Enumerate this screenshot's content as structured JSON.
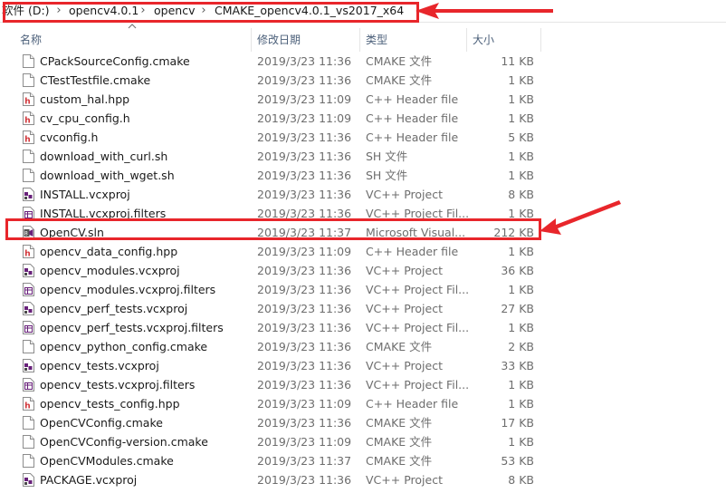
{
  "breadcrumb": {
    "items": [
      "软件 (D:)",
      "opencv4.0.1",
      "opencv",
      "CMAKE_opencv4.0.1_vs2017_x64"
    ],
    "separator": "›"
  },
  "columns": {
    "name": "名称",
    "date": "修改日期",
    "type": "类型",
    "size": "大小"
  },
  "files": [
    {
      "name": "CPackSourceConfig.cmake",
      "date": "2019/3/23 11:36",
      "type": "CMAKE 文件",
      "size": "11 KB",
      "icon": "generic-file-icon"
    },
    {
      "name": "CTestTestfile.cmake",
      "date": "2019/3/23 11:36",
      "type": "CMAKE 文件",
      "size": "1 KB",
      "icon": "generic-file-icon"
    },
    {
      "name": "custom_hal.hpp",
      "date": "2019/3/23 11:09",
      "type": "C++ Header file",
      "size": "1 KB",
      "icon": "cpp-header-icon"
    },
    {
      "name": "cv_cpu_config.h",
      "date": "2019/3/23 11:09",
      "type": "C++ Header file",
      "size": "1 KB",
      "icon": "cpp-header-icon"
    },
    {
      "name": "cvconfig.h",
      "date": "2019/3/23 11:36",
      "type": "C++ Header file",
      "size": "5 KB",
      "icon": "cpp-header-icon"
    },
    {
      "name": "download_with_curl.sh",
      "date": "2019/3/23 11:36",
      "type": "SH 文件",
      "size": "1 KB",
      "icon": "generic-file-icon"
    },
    {
      "name": "download_with_wget.sh",
      "date": "2019/3/23 11:36",
      "type": "SH 文件",
      "size": "1 KB",
      "icon": "generic-file-icon"
    },
    {
      "name": "INSTALL.vcxproj",
      "date": "2019/3/23 11:36",
      "type": "VC++ Project",
      "size": "8 KB",
      "icon": "vcxproj-icon"
    },
    {
      "name": "INSTALL.vcxproj.filters",
      "date": "2019/3/23 11:36",
      "type": "VC++ Project Fil...",
      "size": "1 KB",
      "icon": "filters-file-icon"
    },
    {
      "name": "OpenCV.sln",
      "date": "2019/3/23 11:37",
      "type": "Microsoft Visual...",
      "size": "212 KB",
      "icon": "solution-file-icon"
    },
    {
      "name": "opencv_data_config.hpp",
      "date": "2019/3/23 11:09",
      "type": "C++ Header file",
      "size": "1 KB",
      "icon": "cpp-header-icon"
    },
    {
      "name": "opencv_modules.vcxproj",
      "date": "2019/3/23 11:36",
      "type": "VC++ Project",
      "size": "36 KB",
      "icon": "vcxproj-icon"
    },
    {
      "name": "opencv_modules.vcxproj.filters",
      "date": "2019/3/23 11:36",
      "type": "VC++ Project Fil...",
      "size": "1 KB",
      "icon": "filters-file-icon"
    },
    {
      "name": "opencv_perf_tests.vcxproj",
      "date": "2019/3/23 11:36",
      "type": "VC++ Project",
      "size": "27 KB",
      "icon": "vcxproj-icon"
    },
    {
      "name": "opencv_perf_tests.vcxproj.filters",
      "date": "2019/3/23 11:36",
      "type": "VC++ Project Fil...",
      "size": "1 KB",
      "icon": "filters-file-icon"
    },
    {
      "name": "opencv_python_config.cmake",
      "date": "2019/3/23 11:36",
      "type": "CMAKE 文件",
      "size": "2 KB",
      "icon": "generic-file-icon"
    },
    {
      "name": "opencv_tests.vcxproj",
      "date": "2019/3/23 11:36",
      "type": "VC++ Project",
      "size": "33 KB",
      "icon": "vcxproj-icon"
    },
    {
      "name": "opencv_tests.vcxproj.filters",
      "date": "2019/3/23 11:36",
      "type": "VC++ Project Fil...",
      "size": "1 KB",
      "icon": "filters-file-icon"
    },
    {
      "name": "opencv_tests_config.hpp",
      "date": "2019/3/23 11:09",
      "type": "C++ Header file",
      "size": "1 KB",
      "icon": "cpp-header-icon"
    },
    {
      "name": "OpenCVConfig.cmake",
      "date": "2019/3/23 11:36",
      "type": "CMAKE 文件",
      "size": "17 KB",
      "icon": "generic-file-icon"
    },
    {
      "name": "OpenCVConfig-version.cmake",
      "date": "2019/3/23 11:09",
      "type": "CMAKE 文件",
      "size": "1 KB",
      "icon": "generic-file-icon"
    },
    {
      "name": "OpenCVModules.cmake",
      "date": "2019/3/23 11:37",
      "type": "CMAKE 文件",
      "size": "53 KB",
      "icon": "generic-file-icon"
    },
    {
      "name": "PACKAGE.vcxproj",
      "date": "2019/3/23 11:36",
      "type": "VC++ Project",
      "size": "8 KB",
      "icon": "vcxproj-icon"
    }
  ],
  "colors": {
    "annotation": "#e8262b",
    "header_text": "#4c607a",
    "header_icon": "#d13438",
    "vcxproj_icon": "#68217a"
  }
}
